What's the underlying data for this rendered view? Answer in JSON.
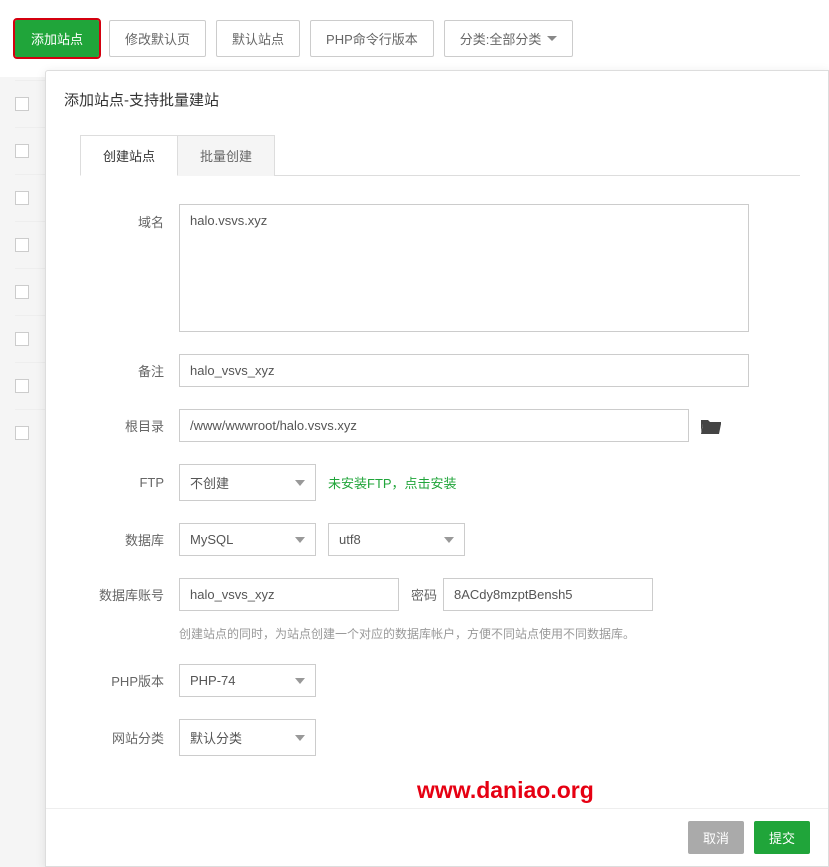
{
  "toolbar": {
    "add_site": "添加站点",
    "edit_default": "修改默认页",
    "default_site": "默认站点",
    "php_cli": "PHP命令行版本",
    "category_prefix": "分类: ",
    "category_value": "全部分类"
  },
  "modal": {
    "title": "添加站点-支持批量建站",
    "tabs": {
      "create_site": "创建站点",
      "bulk_create": "批量创建"
    },
    "form": {
      "domain_label": "域名",
      "domain_value": "halo.vsvs.xyz",
      "remark_label": "备注",
      "remark_value": "halo_vsvs_xyz",
      "root_label": "根目录",
      "root_value": "/www/wwwroot/halo.vsvs.xyz",
      "ftp_label": "FTP",
      "ftp_select": "不创建",
      "ftp_hint": "未安装FTP，点击安装",
      "db_label": "数据库",
      "db_type_select": "MySQL",
      "db_charset_select": "utf8",
      "db_account_label": "数据库账号",
      "db_account_value": "halo_vsvs_xyz",
      "db_password_label": "密码",
      "db_password_value": "8ACdy8mzptBensh5",
      "db_hint": "创建站点的同时，为站点创建一个对应的数据库帐户，方便不同站点使用不同数据库。",
      "php_label": "PHP版本",
      "php_select": "PHP-74",
      "category_label": "网站分类",
      "category_select": "默认分类"
    },
    "footer": {
      "cancel": "取消",
      "submit": "提交"
    }
  },
  "watermark": "www.daniao.org"
}
